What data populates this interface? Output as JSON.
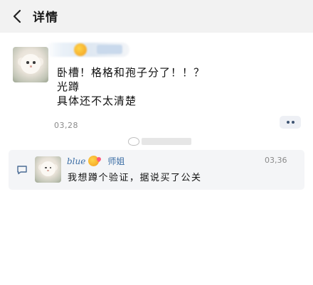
{
  "header": {
    "title": "详情",
    "back_icon": "chevron-left-icon"
  },
  "post": {
    "lines": [
      "卧槽！格格和孢子分了！！？",
      "光蹲",
      "具体还不太清楚"
    ],
    "time": "03,28",
    "more_icon": "more-dots-icon"
  },
  "reply": {
    "icon": "comment-icon",
    "user": "blue",
    "role": "师姐",
    "time": "03,36",
    "text": "我想蹲个验证，据说买了公关"
  },
  "colors": {
    "header_bg": "#f2f2f2",
    "link_blue": "#3c6ea5",
    "reply_bg": "#f4f5f7",
    "more_dot": "#3e5472"
  }
}
